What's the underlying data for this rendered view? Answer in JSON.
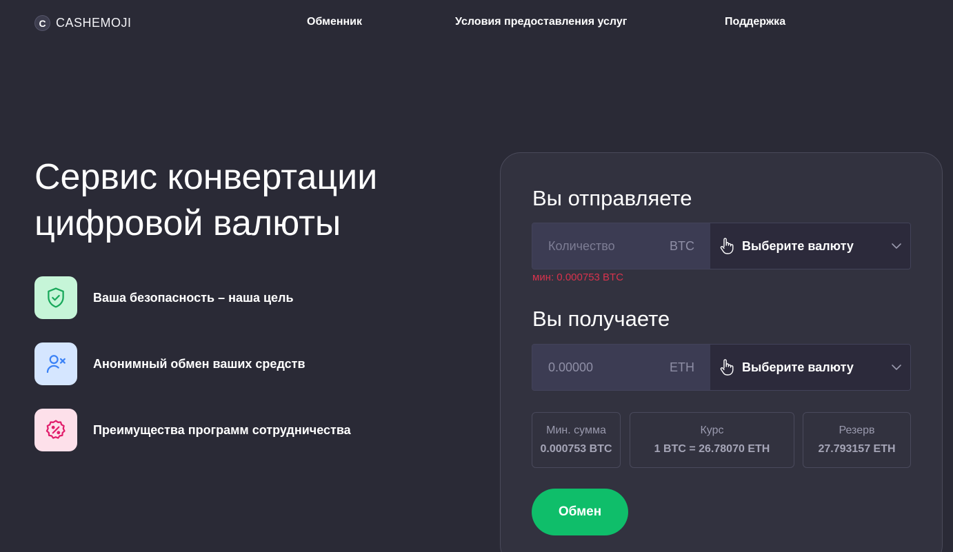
{
  "header": {
    "logo_letter": "C",
    "logo_text": "CASHEMOJI",
    "nav": [
      "Обменник",
      "Условия предоставления услуг",
      "Поддержка"
    ]
  },
  "hero": {
    "title_line1": "Сервис конвертации",
    "title_line2": "цифровой валюты",
    "features": [
      {
        "icon": "shield-check-icon",
        "text": "Ваша безопасность – наша цель",
        "accent": "#18a85a"
      },
      {
        "icon": "user-x-icon",
        "text": "Анонимный обмен ваших средств",
        "accent": "#3b82f6"
      },
      {
        "icon": "percent-badge-icon",
        "text": "Преимущества программ сотрудничества",
        "accent": "#e11d6b"
      }
    ]
  },
  "exchange": {
    "send_label": "Вы отправляете",
    "send_amount_placeholder": "Количество",
    "send_currency": "BTC",
    "send_select_label": "Выберите валюту",
    "min_note": "мин: 0.000753 BTC",
    "receive_label": "Вы получаете",
    "receive_amount": "0.00000",
    "receive_currency": "ETH",
    "receive_select_label": "Выберите валюту",
    "stats": {
      "min_label": "Мин. сумма",
      "min_value": "0.000753 BTC",
      "rate_label": "Курс",
      "rate_value": "1 BTC = 26.78070 ETH",
      "reserve_label": "Резерв",
      "reserve_value": "27.793157 ETH"
    },
    "button_label": "Обмен"
  },
  "colors": {
    "background": "#2a2a36",
    "card": "#32323f",
    "accent_green": "#0fbe6a",
    "error_red": "#d8334d"
  }
}
